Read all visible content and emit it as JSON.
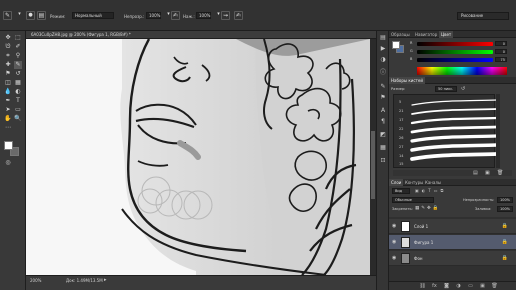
{
  "options_bar": {
    "mode_label": "Режим:",
    "mode_value": "Нормальный",
    "opacity_label": "Непрозр.:",
    "opacity_value": "100%",
    "pressure_label": "Наж.:",
    "pressure_value": "100%",
    "workspace_value": "Рисование"
  },
  "document": {
    "tab_title": "6A03Cu0pZH8.jpg @ 200% (Фигура 1, RGB/8#) *",
    "zoom": "200%",
    "doc_info": "Док: 1.49M/13.5M"
  },
  "color_panel": {
    "tabs": [
      "Образцы",
      "Навигатор",
      "Цвет"
    ],
    "active_tab": 2,
    "channels": [
      {
        "label": "R",
        "value": "0"
      },
      {
        "label": "G",
        "value": "0"
      },
      {
        "label": "B",
        "value": "75"
      }
    ],
    "colors": {
      "foreground": "#ffffff",
      "background": "#6a6a6a",
      "accent": "#4e6ea0"
    }
  },
  "brush_panel": {
    "title": "Наборы кистей",
    "size_label": "Размер:",
    "size_value": "50 пикс.",
    "presets": [
      "5",
      "21",
      "17",
      "22",
      "26",
      "27",
      "14",
      "15"
    ]
  },
  "layers_panel": {
    "tabs": [
      "Слои",
      "Контуры",
      "Каналы"
    ],
    "active_tab": 0,
    "filter_label": "Вид",
    "blend_mode": "Обычные",
    "opacity_label": "Непрозрачность:",
    "opacity_value": "100%",
    "lock_label": "Закрепить:",
    "fill_label": "Заливка:",
    "fill_value": "100%",
    "layers": [
      {
        "name": "Слой 1",
        "selected": false,
        "eye": "◉",
        "lock": "🔒"
      },
      {
        "name": "Фигура 1",
        "selected": true,
        "eye": "◉",
        "lock": "🔒"
      },
      {
        "name": "Фон",
        "selected": false,
        "eye": "◉",
        "lock": "🔒"
      }
    ]
  }
}
